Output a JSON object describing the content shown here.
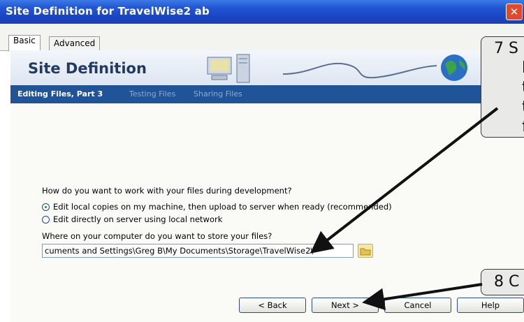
{
  "window": {
    "title": "Site Definition for TravelWise2 ab",
    "close_label": "✕"
  },
  "tabs": [
    {
      "label": "Basic"
    },
    {
      "label": "Advanced"
    }
  ],
  "banner": {
    "title": "Site Definition"
  },
  "steps": [
    "Editing Files, Part 3",
    "Testing Files",
    "Sharing Files"
  ],
  "question": "How do you want to work with your files during development?",
  "options": [
    {
      "label": "Edit local copies on my machine, then upload to server when ready (recommended)",
      "selected": true
    },
    {
      "label": "Edit directly on server using local network",
      "selected": false
    }
  ],
  "path_field": {
    "label": "Where on your computer do you want to store your files?",
    "value": "cuments and Settings\\Greg B\\My Documents\\Storage\\TravelWise2\\"
  },
  "buttons": {
    "back": "< Back",
    "next": "Next >",
    "cancel": "Cancel",
    "help": "Help"
  },
  "callouts": {
    "c7": [
      "7  S",
      "b",
      "t",
      "t",
      "f"
    ],
    "c8": "8  C"
  },
  "colors": {
    "titlebar": "#2357d4",
    "steps_bar": "#1f5598",
    "banner_text": "#223a63"
  }
}
